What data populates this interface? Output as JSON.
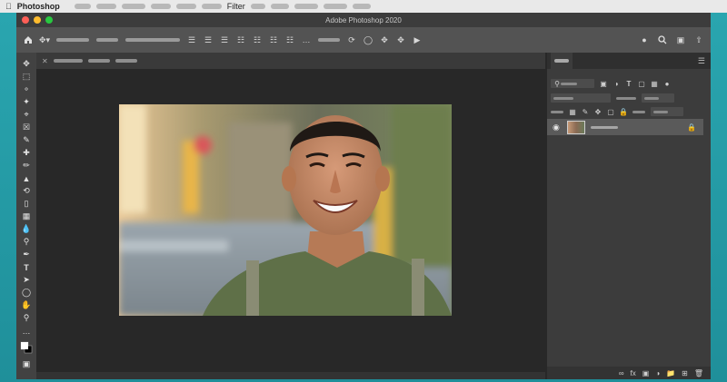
{
  "menubar": {
    "app_name": "Photoshop",
    "filter_menu": "Filter"
  },
  "window": {
    "title": "Adobe Photoshop 2020"
  },
  "colors": {
    "desktop": "#2aa6b0",
    "window_bg": "#282828",
    "options_bar": "#535353",
    "panel_bg": "#3c3c3c",
    "selected_layer": "#5a5a5a"
  },
  "toolbar": {
    "tools": [
      "move",
      "marquee",
      "lasso",
      "magic-wand",
      "crop",
      "frame",
      "eyedropper",
      "spot-healing",
      "brush",
      "clone-stamp",
      "history-brush",
      "eraser",
      "gradient",
      "blur",
      "dodge",
      "pen",
      "type",
      "path-selection",
      "rectangle",
      "hand",
      "zoom",
      "more",
      "colors"
    ]
  },
  "canvas": {
    "image": "smiling-man-portrait"
  },
  "layers": {
    "selected_layer_visible": true,
    "selected_layer_locked": true
  }
}
